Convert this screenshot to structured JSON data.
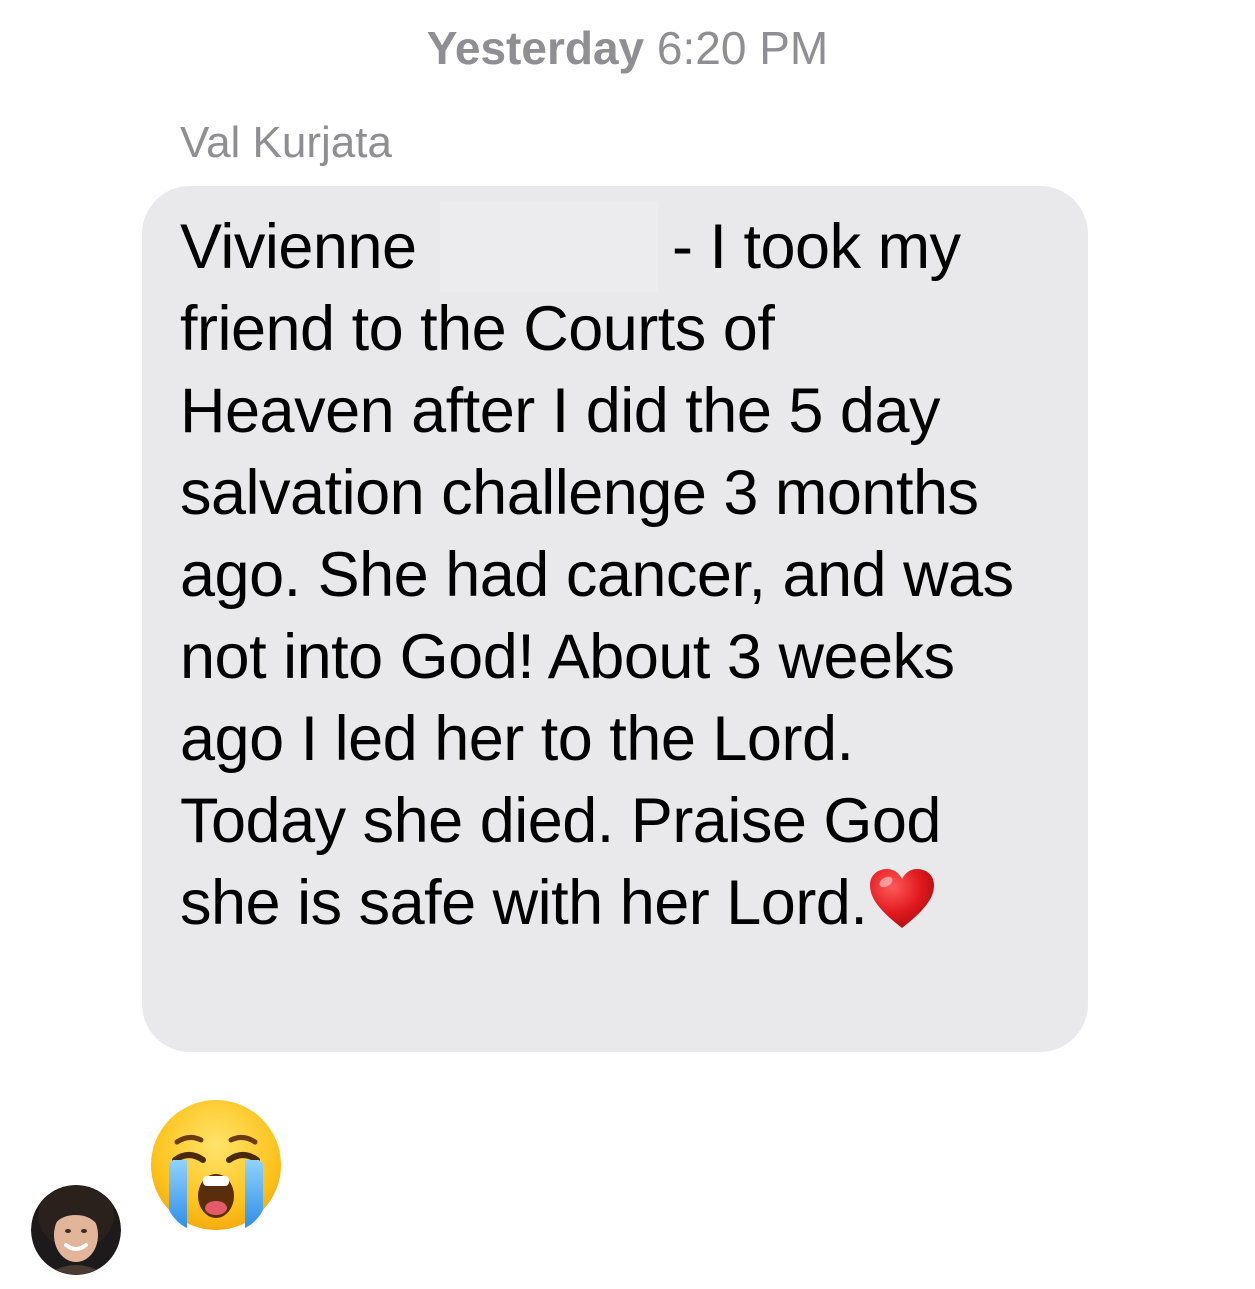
{
  "conversation": {
    "timestamp_day": "Yesterday",
    "timestamp_time": "6:20 PM",
    "sender_name": "Val Kurjata"
  },
  "message": {
    "lines": [
      "Vivienne",
      "- I took my",
      "friend to the Courts of",
      "Heaven after I did the 5 day",
      "salvation challenge 3 months",
      "ago. She had cancer, and was",
      "not into God! About 3 weeks",
      "ago I led her to the Lord.",
      "Today she died. Praise God",
      "she is safe with her Lord."
    ],
    "trailing_emoji": "red-heart",
    "bubble_color": "#e9e9eb"
  },
  "reaction": {
    "emoji": "loudly-crying-face"
  },
  "avatar": {
    "icon": "user-avatar-photo"
  },
  "colors": {
    "meta_text": "#8e8e93",
    "message_text": "#000000",
    "background": "#ffffff"
  }
}
